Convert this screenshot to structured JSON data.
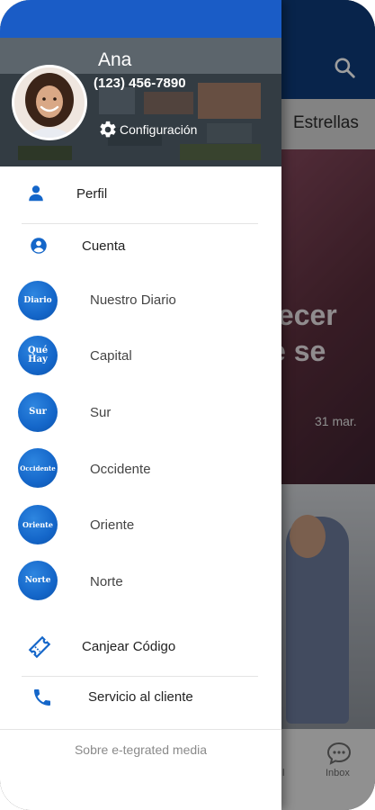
{
  "background_app": {
    "tab_label": "Estrellas",
    "hero_text": "lecer\ne se",
    "hero_date": "31 mar.",
    "bottom_nav": {
      "partial_label": "l",
      "inbox_label": "Inbox"
    }
  },
  "drawer": {
    "user": {
      "name": "Ana",
      "phone": "(123) 456-7890"
    },
    "settings_label": "Configuración",
    "menu": [
      {
        "label": "Perfil",
        "icon": "person-icon"
      },
      {
        "label": "Cuenta",
        "icon": "account-circle-icon"
      }
    ],
    "editions": [
      {
        "label": "Nuestro Diario",
        "badge": "Diario"
      },
      {
        "label": "Capital",
        "badge": "Qué Hay"
      },
      {
        "label": "Sur",
        "badge": "Sur"
      },
      {
        "label": "Occidente",
        "badge": "Occidente"
      },
      {
        "label": "Oriente",
        "badge": "Oriente"
      },
      {
        "label": "Norte",
        "badge": "Norte"
      }
    ],
    "actions": [
      {
        "label": "Canjear Código",
        "icon": "ticket-icon"
      },
      {
        "label": "Servicio al cliente",
        "icon": "phone-icon"
      }
    ],
    "footer_label": "Sobre e-tegrated media"
  },
  "colors": {
    "accent_blue": "#1a5cc6",
    "icon_blue": "#1466c9",
    "badge_blue": "#1466c9"
  }
}
